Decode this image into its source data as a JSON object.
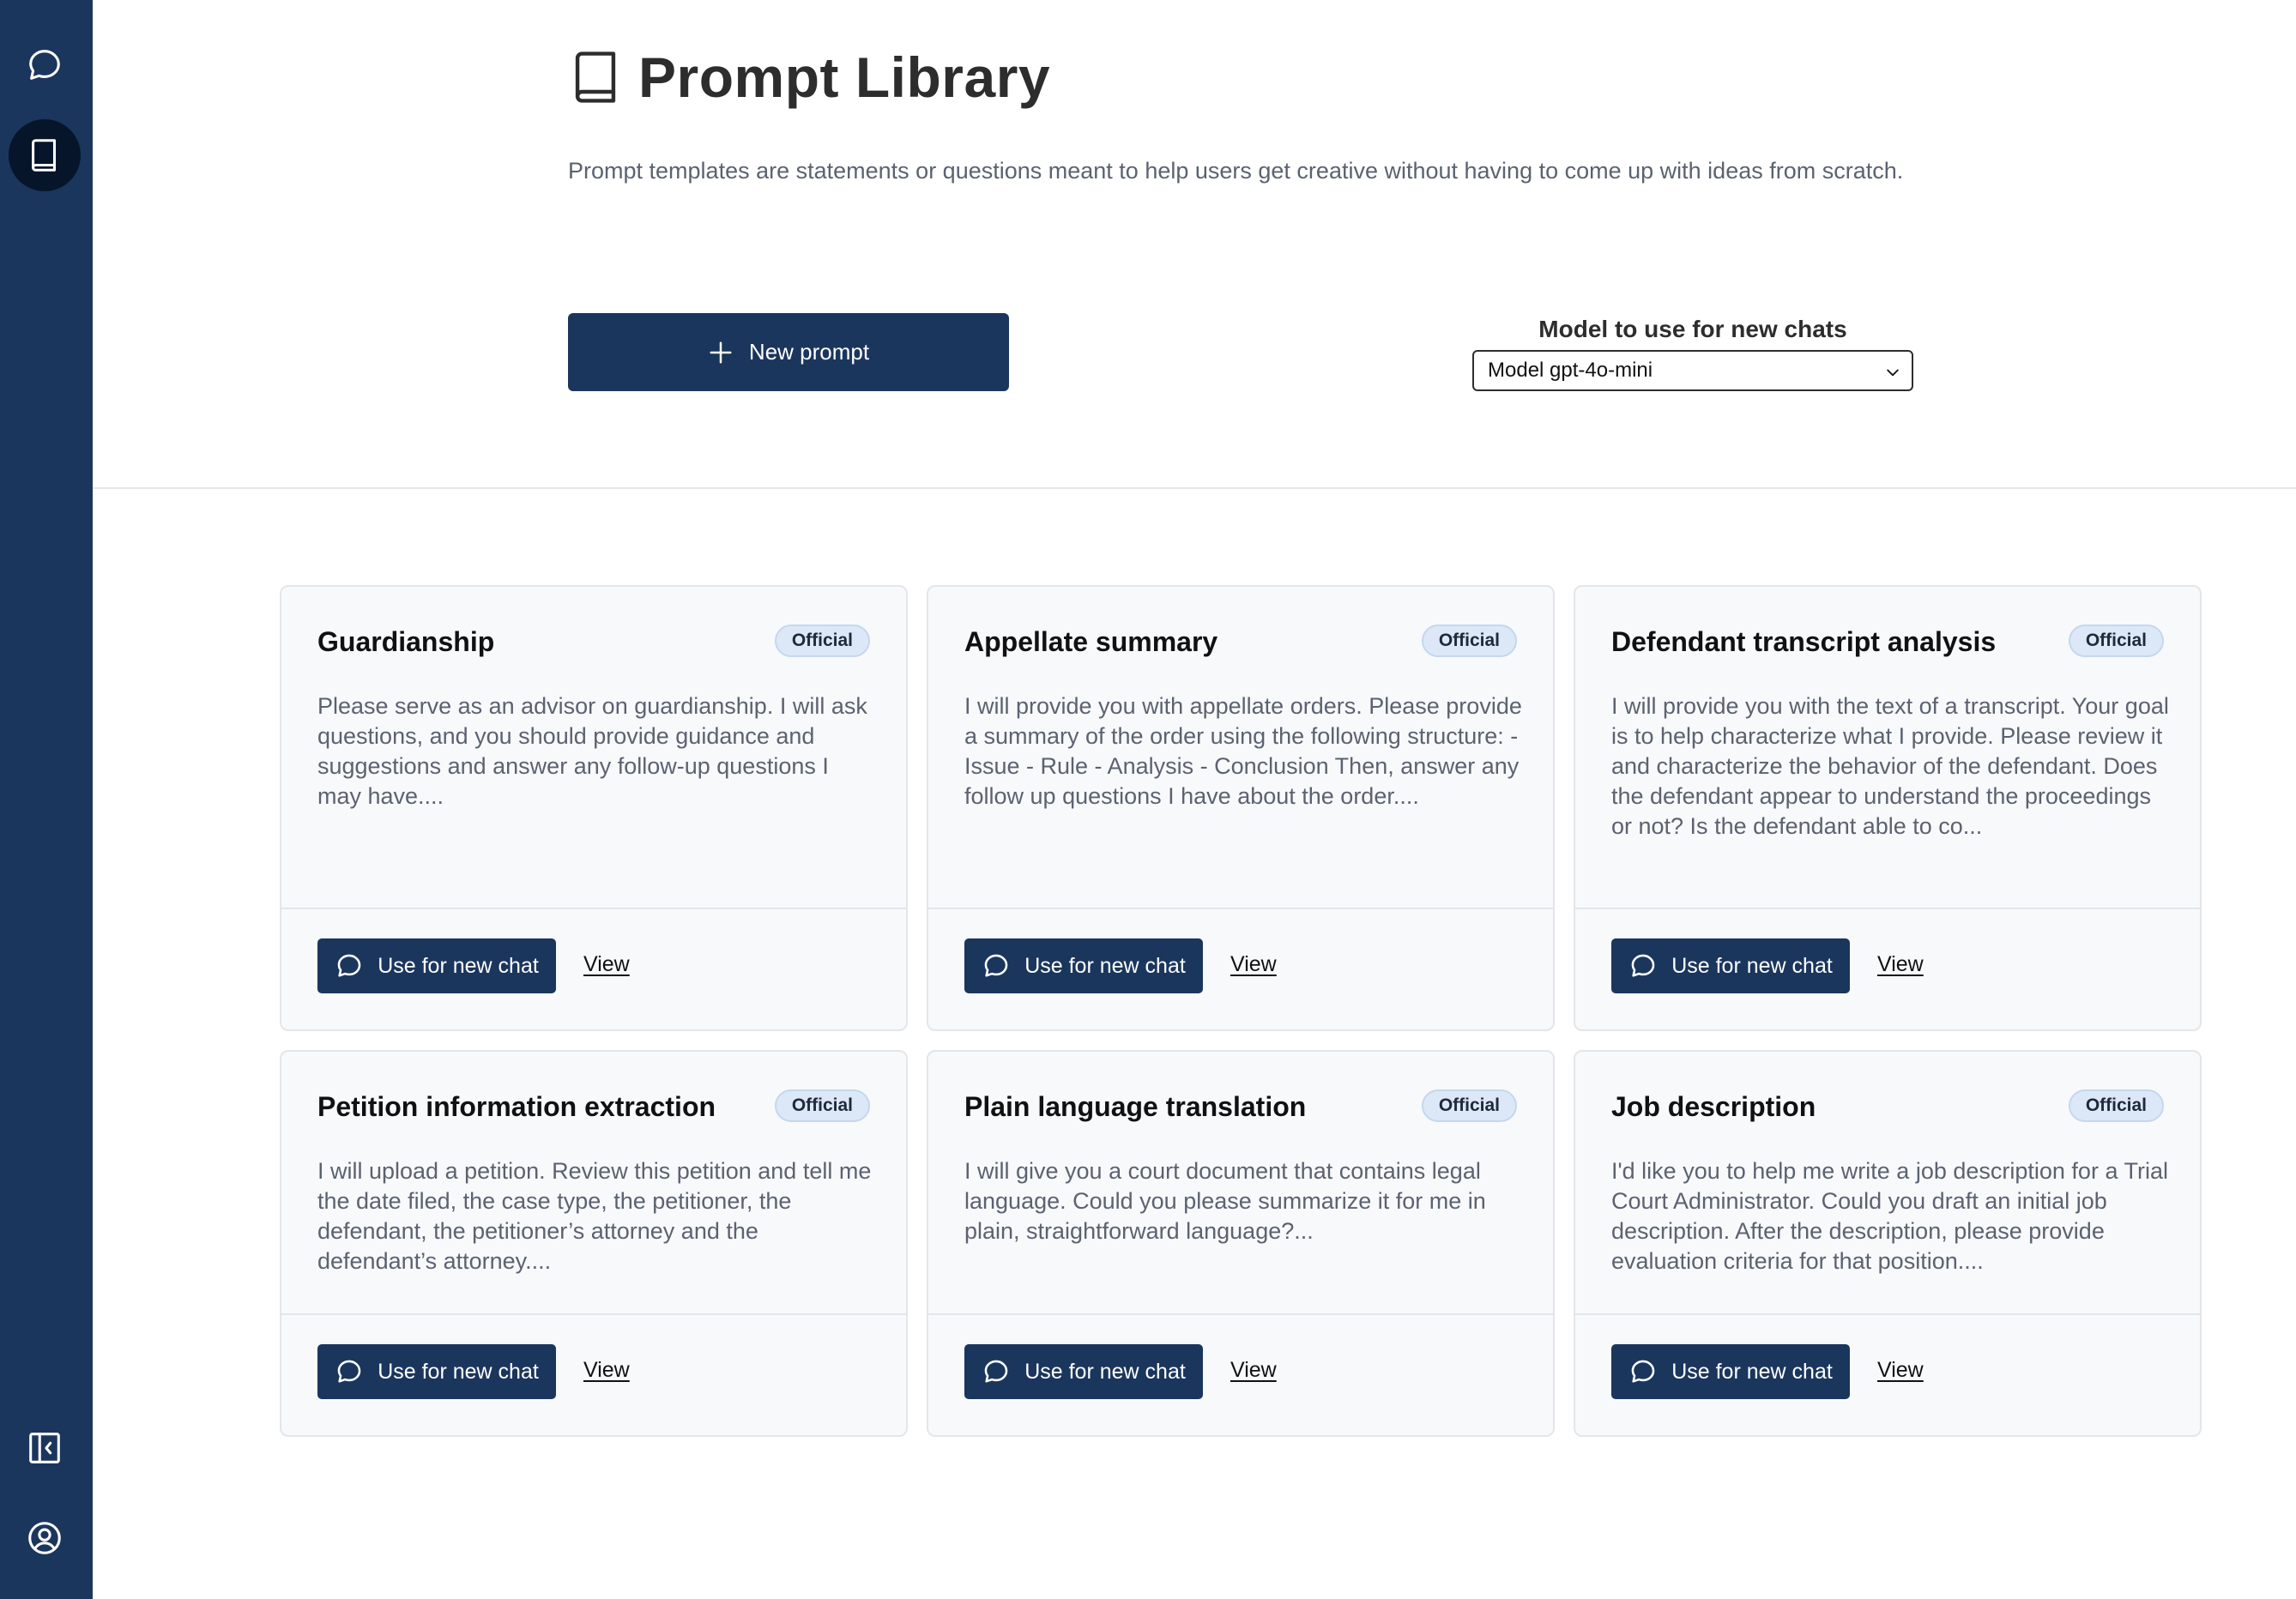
{
  "sidebar": {
    "items": [
      {
        "icon": "chat-bubble-icon",
        "active": false
      },
      {
        "icon": "book-icon",
        "active": true
      },
      {
        "icon": "collapse-sidebar-icon",
        "active": false
      },
      {
        "icon": "user-account-icon",
        "active": false
      }
    ]
  },
  "header": {
    "title": "Prompt Library",
    "description": "Prompt templates are statements or questions meant to help users get creative without having to come up with ideas from scratch."
  },
  "toolbar": {
    "new_prompt_label": "New prompt",
    "model_label": "Model to use for new chats",
    "model_selected": "Model gpt-4o-mini"
  },
  "colors": {
    "brand": "#1b365d",
    "badge_bg": "#dce8f7"
  },
  "cards": [
    {
      "title": "Guardianship",
      "badge": "Official",
      "text": "Please serve as an advisor on guardianship. I will ask questions, and you should provide guidance and suggestions and answer any follow-up questions I may have....",
      "use_label": "Use for new chat",
      "view_label": "View"
    },
    {
      "title": "Appellate summary",
      "badge": "Official",
      "text": "I will provide you with appellate orders. Please provide a summary of the order using the following structure: - Issue - Rule - Analysis - Conclusion Then, answer any follow up questions I have about the order....",
      "use_label": "Use for new chat",
      "view_label": "View"
    },
    {
      "title": "Defendant transcript analysis",
      "badge": "Official",
      "text": "I will provide you with the text of a transcript. Your goal is to help characterize what I provide. Please review it and characterize the behavior of the defendant. Does the defendant appear to understand the proceedings or not? Is the defendant able to co...",
      "use_label": "Use for new chat",
      "view_label": "View"
    },
    {
      "title": "Petition information extraction",
      "badge": "Official",
      "text": "I will upload a petition. Review this petition and tell me the date filed, the case type, the petitioner, the defendant, the petitioner’s attorney and the defendant’s attorney....",
      "use_label": "Use for new chat",
      "view_label": "View"
    },
    {
      "title": "Plain language translation",
      "badge": "Official",
      "text": "I will give you a court document that contains legal language. Could you please summarize it for me in plain, straightforward language?...",
      "use_label": "Use for new chat",
      "view_label": "View"
    },
    {
      "title": "Job description",
      "badge": "Official",
      "text": "I'd like you to help me write a job description for a Trial Court Administrator. Could you draft an initial job description. After the description, please provide evaluation criteria for that position....",
      "use_label": "Use for new chat",
      "view_label": "View"
    }
  ]
}
